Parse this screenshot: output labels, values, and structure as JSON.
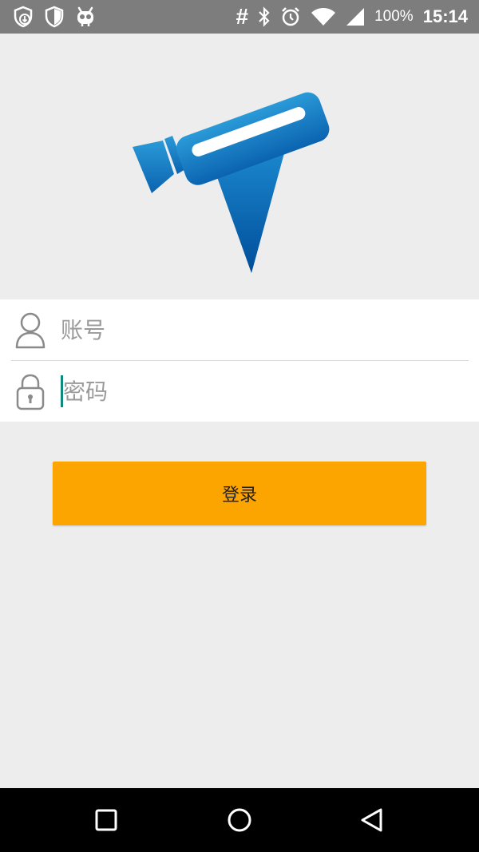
{
  "status_bar": {
    "battery_percent": "100%",
    "time": "15:14",
    "icons": [
      "shield-download-icon",
      "shield-icon",
      "android-robot-icon",
      "hash-icon",
      "bluetooth-icon",
      "alarm-icon",
      "wifi-icon",
      "signal-icon",
      "battery-icon"
    ]
  },
  "logo": {
    "icon": "telescope-logo-icon",
    "colors": {
      "primary": "#1a7fc4",
      "dark": "#0a5aa8"
    }
  },
  "form": {
    "account": {
      "placeholder": "账号",
      "value": "",
      "icon": "user-icon"
    },
    "password": {
      "placeholder": "密码",
      "value": "",
      "icon": "lock-icon"
    }
  },
  "login_button": {
    "label": "登录",
    "color": "#fca400"
  },
  "nav_bar": {
    "icons": [
      "recent-apps-icon",
      "home-icon",
      "back-icon"
    ]
  }
}
